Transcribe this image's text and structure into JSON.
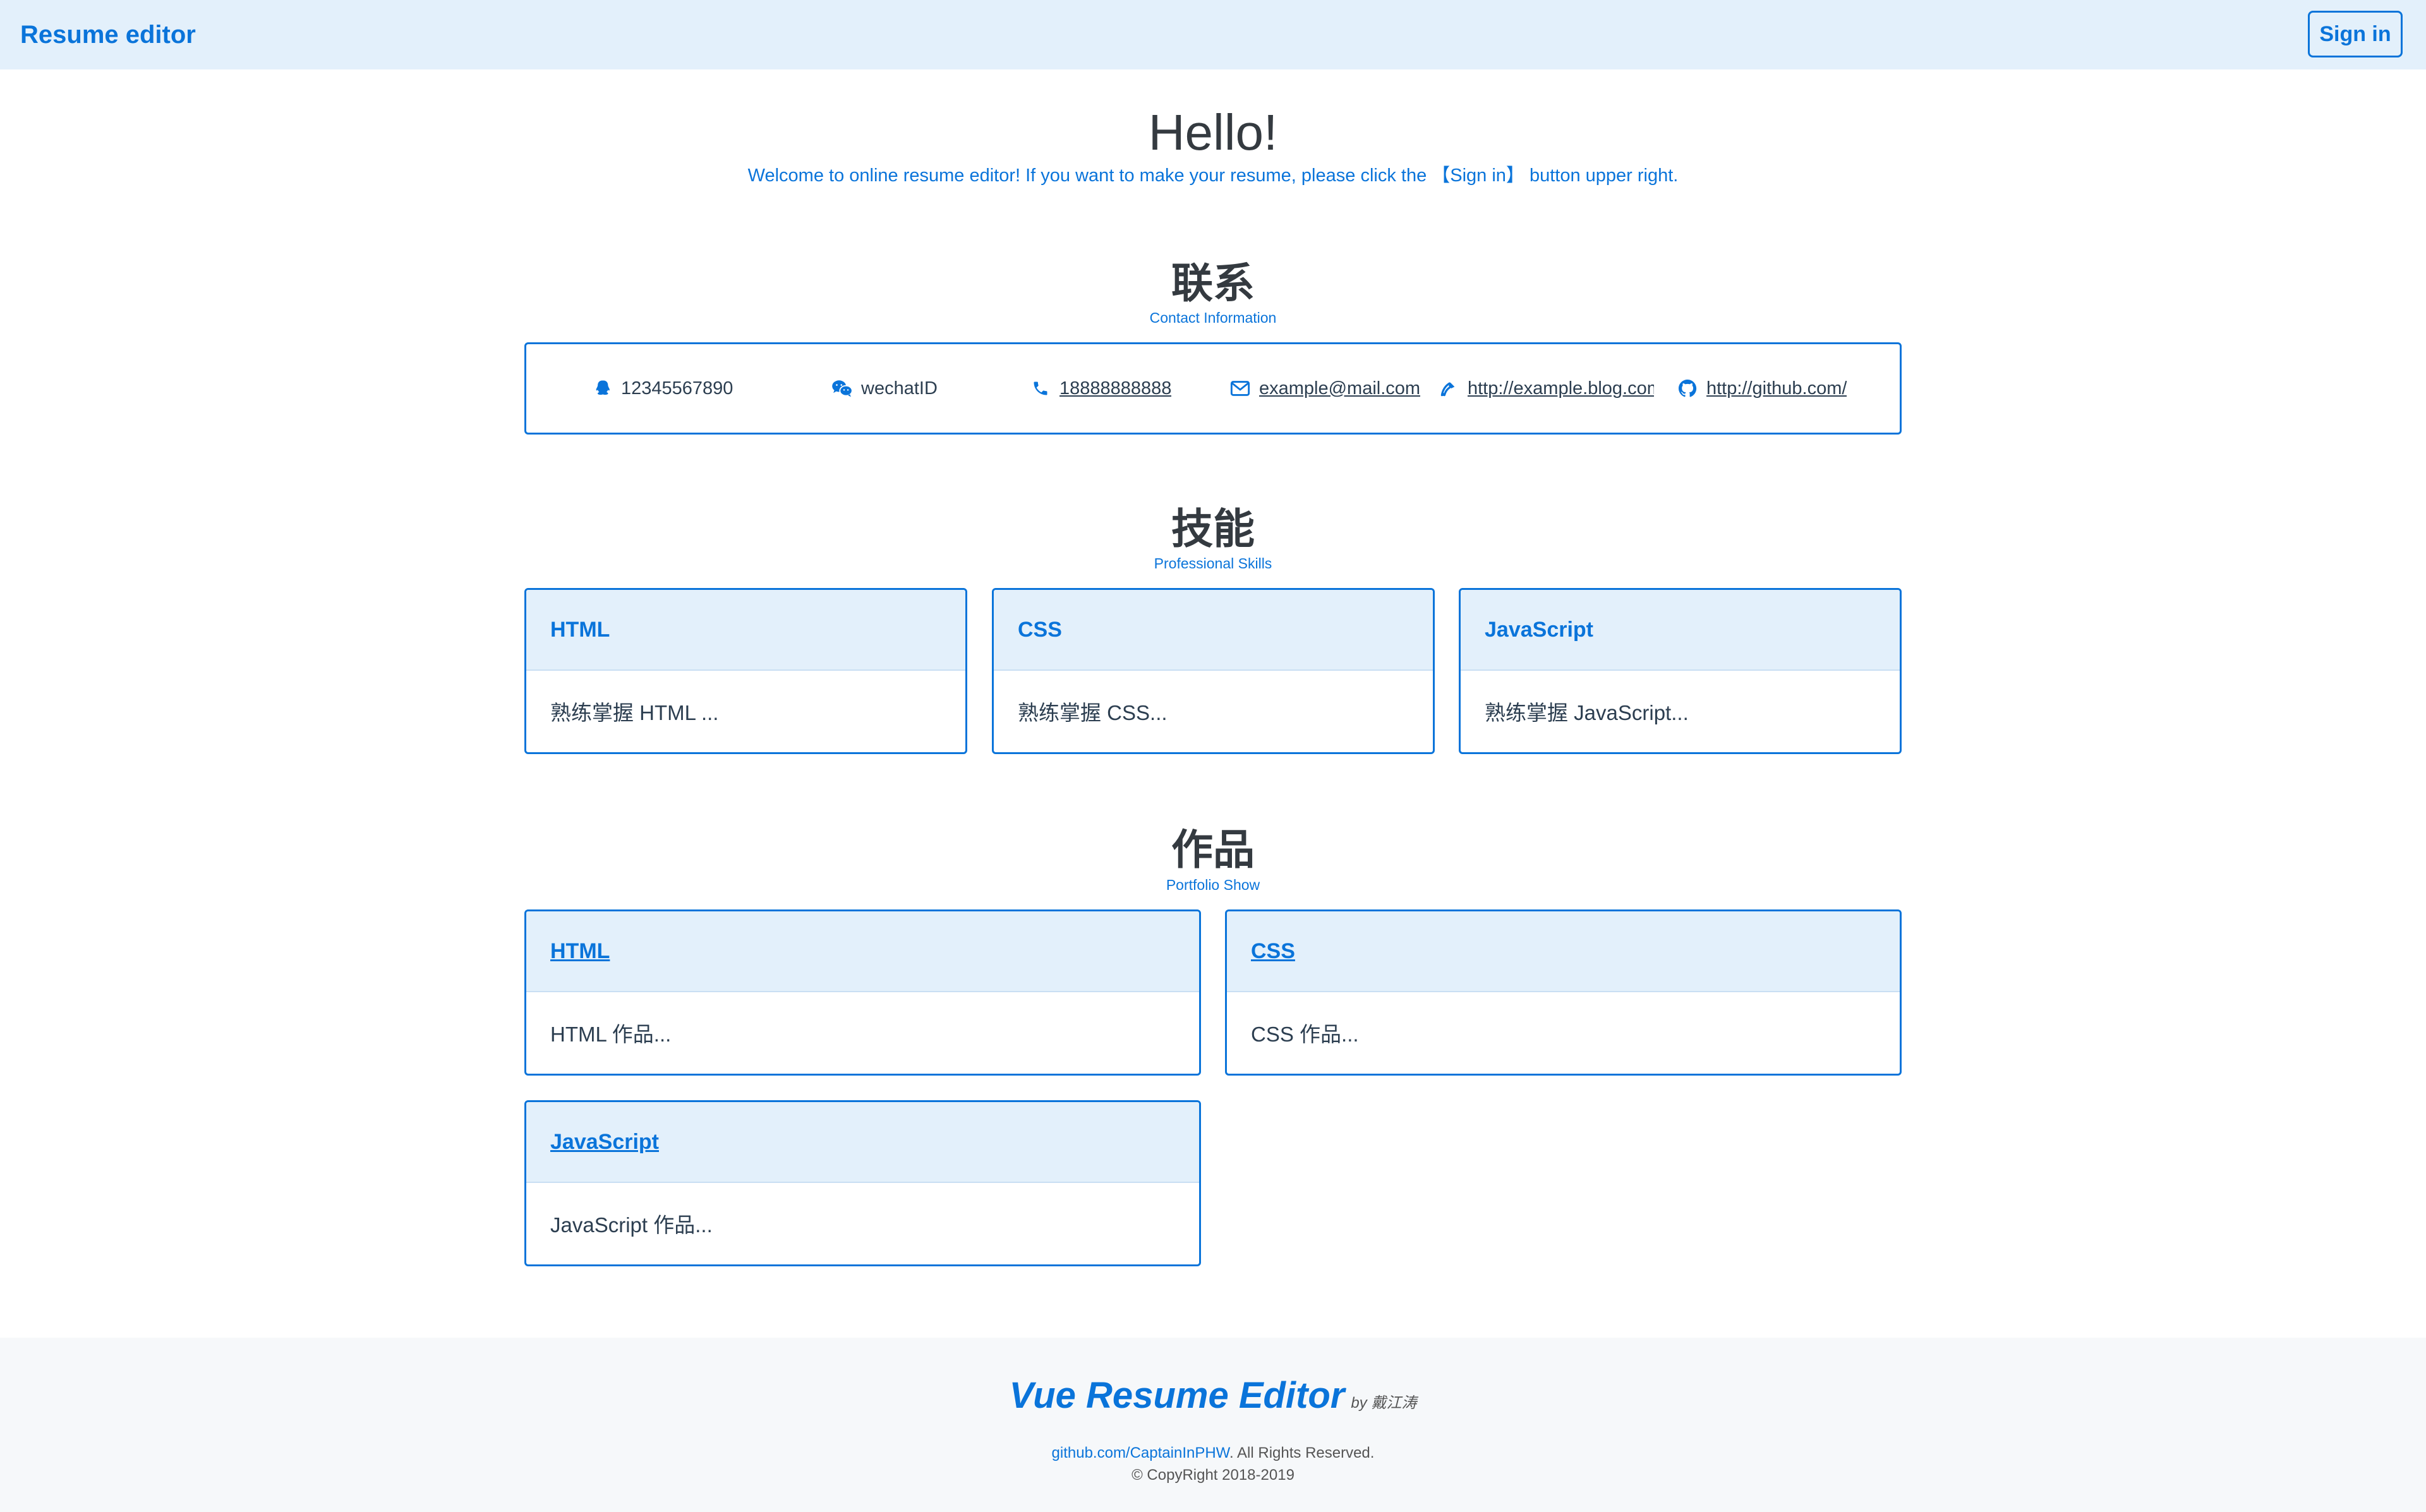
{
  "navbar": {
    "brand": "Resume editor",
    "signin_label": "Sign in"
  },
  "hero": {
    "title": "Hello!",
    "subtitle": "Welcome to online resume editor! If you want to make your resume, please click the 【Sign in】 button upper right."
  },
  "contact": {
    "title": "联系",
    "subtitle": "Contact Information",
    "items": [
      {
        "icon": "qq-icon",
        "text": "12345567890"
      },
      {
        "icon": "wechat-icon",
        "text": "wechatID"
      },
      {
        "icon": "phone-icon",
        "text": "18888888888"
      },
      {
        "icon": "mail-icon",
        "text": "example@mail.com"
      },
      {
        "icon": "blog-icon",
        "text": "http://example.blog.com"
      },
      {
        "icon": "github-icon",
        "text": "http://github.com/"
      }
    ]
  },
  "skills": {
    "title": "技能",
    "subtitle": "Professional Skills",
    "items": [
      {
        "name": "HTML",
        "desc": "熟练掌握 HTML ..."
      },
      {
        "name": "CSS",
        "desc": "熟练掌握 CSS..."
      },
      {
        "name": "JavaScript",
        "desc": "熟练掌握 JavaScript..."
      }
    ]
  },
  "portfolio": {
    "title": "作品",
    "subtitle": "Portfolio Show",
    "items": [
      {
        "name": "HTML",
        "desc": "HTML 作品..."
      },
      {
        "name": "CSS",
        "desc": "CSS 作品..."
      },
      {
        "name": "JavaScript",
        "desc": "JavaScript 作品..."
      }
    ]
  },
  "footer": {
    "title": "Vue Resume Editor",
    "by": "by 戴江涛",
    "link": "github.com/CaptainInPHW",
    "rights": ". All Rights Reserved.",
    "copyright": "© CopyRight 2018-2019"
  },
  "colors": {
    "accent": "#0a74da",
    "header_bg": "#e3f0fb",
    "text": "#2c3e50"
  }
}
